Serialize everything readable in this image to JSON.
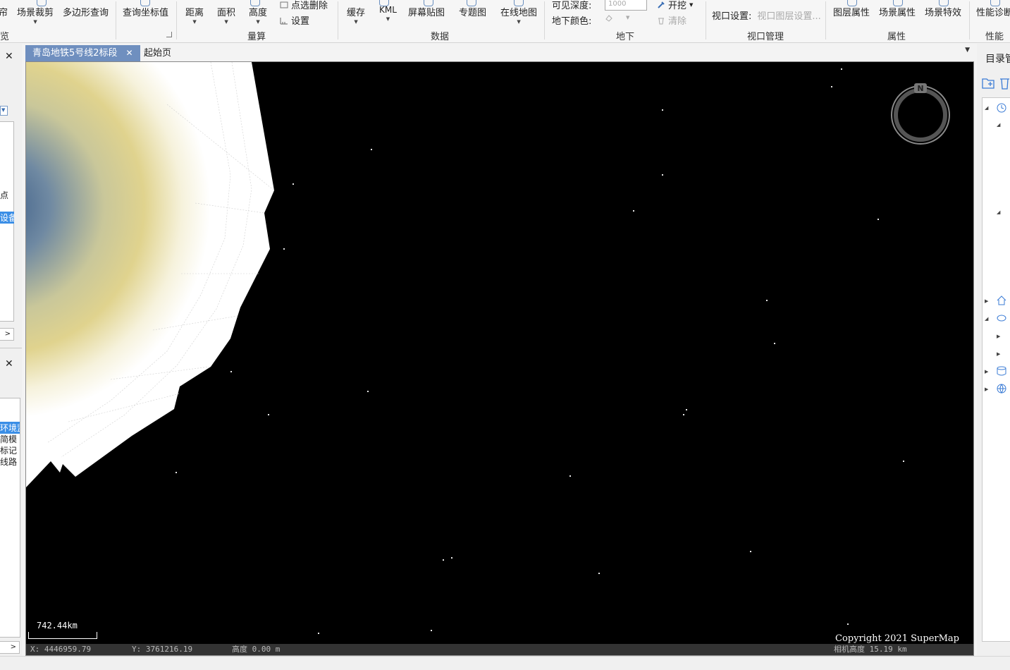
{
  "ribbon": {
    "buttons": {
      "curtain": "帘",
      "scene_clip": "场景裁剪",
      "polygon_query": "多边形查询",
      "query_coord": "查询坐标值",
      "distance": "距离",
      "area": "面积",
      "height": "高度",
      "point_delete": "点选删除",
      "settings": "设置",
      "cache": "缓存",
      "kml": "KML",
      "screen_map": "屏幕贴图",
      "thematic_map": "专题图",
      "online_map": "在线地图",
      "visible_depth_label": "可见深度:",
      "visible_depth_value": "1000",
      "underground_color_label": "地下颜色:",
      "excavate": "开挖",
      "clear": "清除",
      "viewport_settings_label": "视口设置:",
      "viewport_layer_settings": "视口图层设置...",
      "layer_properties": "图层属性",
      "scene_properties": "场景属性",
      "scene_effects": "场景特效",
      "performance_diagnosis": "性能诊断"
    },
    "groups": {
      "browse": "览",
      "measure": "量算",
      "data": "数据",
      "underground": "地下",
      "viewport_management": "视口管理",
      "properties": "属性",
      "performance": "性能"
    }
  },
  "left_panel": {
    "items_top": [
      "点",
      "设备"
    ],
    "items_bottom": [
      "环境监",
      "简模",
      "标记",
      "线路"
    ]
  },
  "tabs": [
    {
      "label": "青岛地铁5号线2标段",
      "active": true
    },
    {
      "label": "起始页",
      "active": false
    }
  ],
  "scene": {
    "scale_label": "742.44km",
    "copyright": "Copyright 2021 SuperMap",
    "compass_letter": "N",
    "status": {
      "x": "X: 4446959.79",
      "y": "Y: 3761216.19",
      "height": "高度 0.00 m",
      "camera_height": "相机高度 15.19 km"
    }
  },
  "right_panel": {
    "title": "目录管"
  },
  "colors": {
    "tab_active": "#6f8fbf",
    "scene_background": "#000000",
    "selection": "#3a8ee6"
  }
}
